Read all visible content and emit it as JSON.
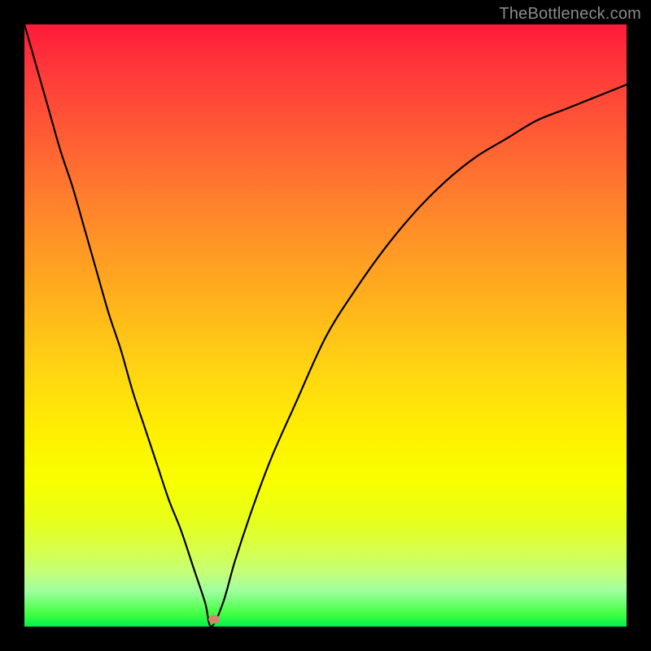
{
  "watermark": "TheBottleneck.com",
  "marker_color": "#d6836e",
  "chart_data": {
    "type": "line",
    "title": "",
    "xlabel": "",
    "ylabel": "",
    "xlim": [
      0,
      100
    ],
    "ylim": [
      0,
      100
    ],
    "series": [
      {
        "name": "bottleneck-curve",
        "x": [
          0,
          2,
          4,
          6,
          8,
          10,
          12,
          14,
          16,
          18,
          20,
          22,
          24,
          26,
          28,
          30,
          31,
          33,
          35,
          38,
          41,
          45,
          50,
          55,
          60,
          65,
          70,
          75,
          80,
          85,
          90,
          95,
          100
        ],
        "values": [
          100,
          93,
          86,
          79,
          73,
          66,
          59,
          52,
          46,
          39,
          33,
          27,
          21,
          16,
          10,
          4,
          0,
          4,
          11,
          20,
          28,
          37,
          48,
          56,
          63,
          69,
          74,
          78,
          81,
          84,
          86,
          88,
          90
        ]
      }
    ],
    "marker": {
      "x": 31.5,
      "y": 1.2,
      "color": "#d6836e"
    }
  }
}
